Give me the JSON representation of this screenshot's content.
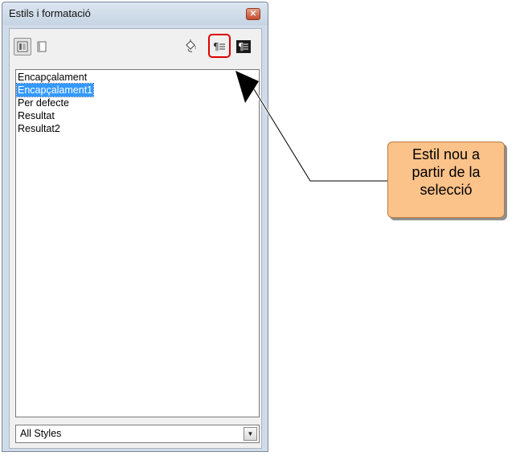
{
  "window": {
    "title": "Estils i formatació",
    "close_symbol": "✕"
  },
  "toolbar": {
    "paragraph_styles_icon": "paragraph-styles-icon",
    "page_styles_icon": "page-styles-icon",
    "fill_format_icon": "paint-bucket-icon",
    "new_style_from_selection_icon": "new-style-from-selection-icon",
    "update_style_icon": "update-style-icon",
    "highlight_color": "#e00000"
  },
  "styles_list": {
    "items": [
      {
        "label": "Encapçalament",
        "selected": false
      },
      {
        "label": "Encapçalament1",
        "selected": true
      },
      {
        "label": "Per defecte",
        "selected": false
      },
      {
        "label": "Resultat",
        "selected": false
      },
      {
        "label": "Resultat2",
        "selected": false
      }
    ],
    "selection_color": "#3399ff"
  },
  "filter": {
    "selected": "All Styles"
  },
  "callout": {
    "lines": [
      "Estil nou a",
      "partir de la",
      "selecció"
    ],
    "fill_color": "#fbc28a"
  }
}
